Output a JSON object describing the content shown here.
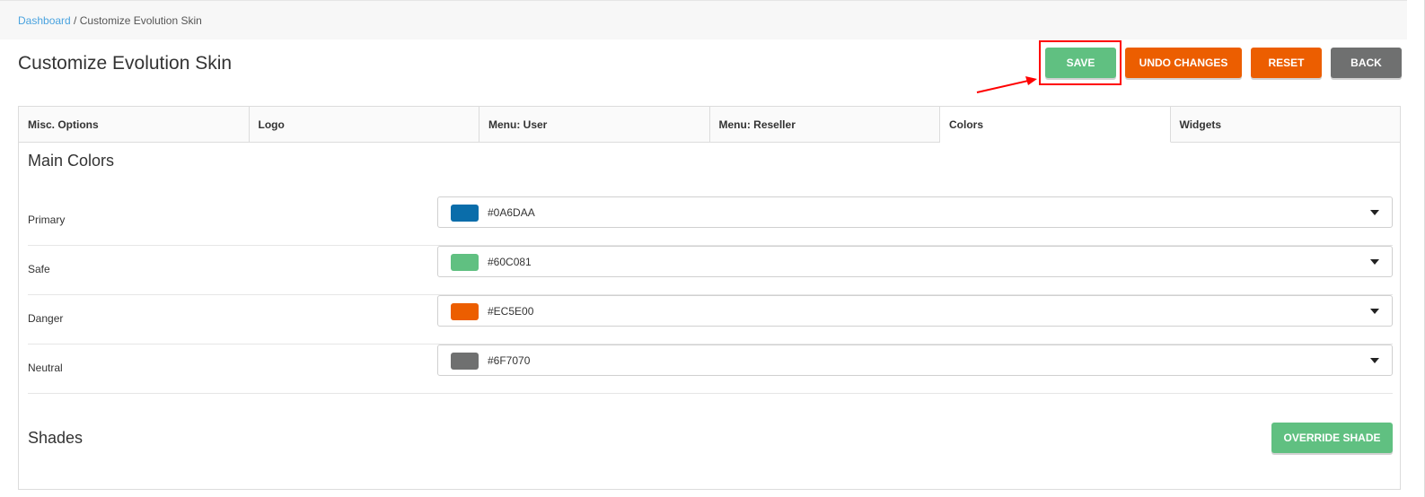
{
  "breadcrumb": {
    "root": "Dashboard",
    "separator": " / ",
    "current": "Customize Evolution Skin"
  },
  "page_title": "Customize Evolution Skin",
  "toolbar": {
    "save_label": "SAVE",
    "undo_label": "UNDO CHANGES",
    "reset_label": "RESET",
    "back_label": "BACK"
  },
  "tabs": [
    {
      "label": "Misc. Options",
      "active": false
    },
    {
      "label": "Logo",
      "active": false
    },
    {
      "label": "Menu: User",
      "active": false
    },
    {
      "label": "Menu: Reseller",
      "active": false
    },
    {
      "label": "Colors",
      "active": true
    },
    {
      "label": "Widgets",
      "active": false
    }
  ],
  "main_colors": {
    "title": "Main Colors",
    "rows": [
      {
        "label": "Primary",
        "value": "#0A6DAA",
        "swatch": "#0a6daa"
      },
      {
        "label": "Safe",
        "value": "#60C081",
        "swatch": "#60c081"
      },
      {
        "label": "Danger",
        "value": "#EC5E00",
        "swatch": "#ec5e00"
      },
      {
        "label": "Neutral",
        "value": "#6F7070",
        "swatch": "#6f7070"
      }
    ]
  },
  "shades": {
    "title": "Shades",
    "override_label": "OVERRIDE SHADE"
  },
  "icons": {
    "dropdown": "caret-down-icon",
    "annotation": "red-arrow-icon"
  },
  "colors": {
    "accent_link": "#4aa3df",
    "safe": "#60c081",
    "danger": "#ec5e00",
    "neutral": "#6f7070",
    "annotation": "#ff0000"
  }
}
